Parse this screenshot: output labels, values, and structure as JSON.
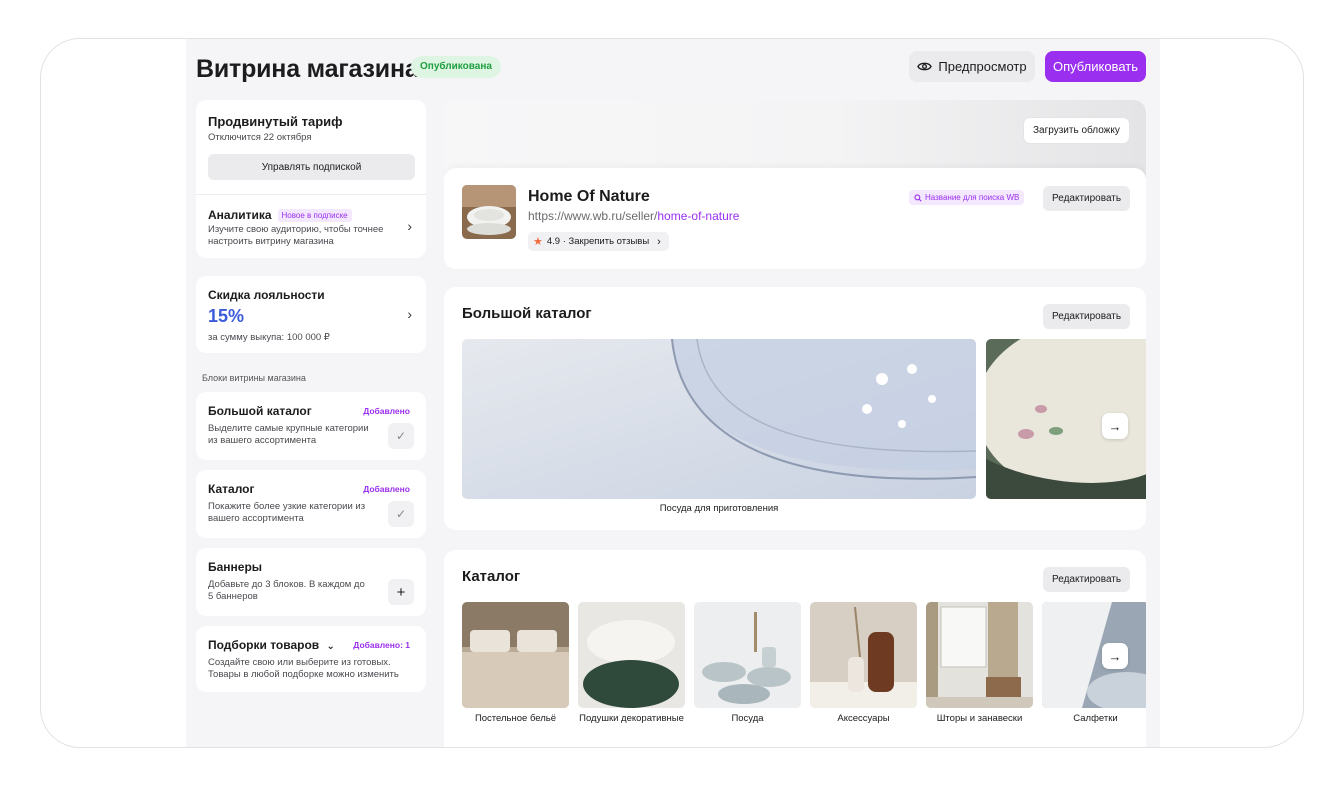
{
  "header": {
    "title": "Витрина магазина",
    "status_badge": "Опубликована",
    "preview_label": "Предпросмотр",
    "publish_label": "Опубликовать"
  },
  "sidebar": {
    "plan": {
      "title": "Продвинутый тариф",
      "subtitle": "Отключится 22 октября",
      "manage_label": "Управлять подпиской"
    },
    "analytics": {
      "title": "Аналитика",
      "tag": "Новое в подписке",
      "text": "Изучите свою аудиторию, чтобы точнее настроить витрину магазина"
    },
    "loyalty": {
      "title": "Скидка лояльности",
      "value": "15%",
      "text": "за сумму выкупа: 100 000 ₽"
    },
    "blocks_label": "Блоки витрины магазина",
    "blocks": [
      {
        "title": "Большой каталог",
        "status": "Добавлено",
        "text": "Выделите самые крупные категории из вашего ассортимента",
        "action": "✓"
      },
      {
        "title": "Каталог",
        "status": "Добавлено",
        "text": "Покажите более узкие категории из вашего ассортимента",
        "action": "✓"
      },
      {
        "title": "Баннеры",
        "status": "",
        "text": "Добавьте до 3 блоков. В каждом до 5 баннеров",
        "action": "+"
      },
      {
        "title": "Подборки товаров",
        "status": "Добавлено: 1",
        "text": "Создайте свою или выберите из готовых. Товары в любой подборке можно изменить",
        "action": ""
      }
    ]
  },
  "store": {
    "upload_cover_label": "Загрузить обложку",
    "name": "Home Of Nature",
    "url_prefix": "https://www.wb.ru/seller/",
    "url_slug": "home-of-nature",
    "rating": "4.9 · Закрепить отзывы",
    "search_tag": "Название для поиска WB",
    "edit_label": "Редактировать"
  },
  "big_catalog": {
    "title": "Большой каталог",
    "edit_label": "Редактировать",
    "items": [
      "Посуда для приготовления"
    ]
  },
  "catalog": {
    "title": "Каталог",
    "edit_label": "Редактировать",
    "items": [
      "Постельное бельё",
      "Подушки декоративные",
      "Посуда",
      "Аксессуары",
      "Шторы и занавески",
      "Салфетки"
    ]
  },
  "colors": {
    "accent": "#9b2ff0",
    "published": "#1e9e3e",
    "loyalty": "#3b5bdb"
  }
}
